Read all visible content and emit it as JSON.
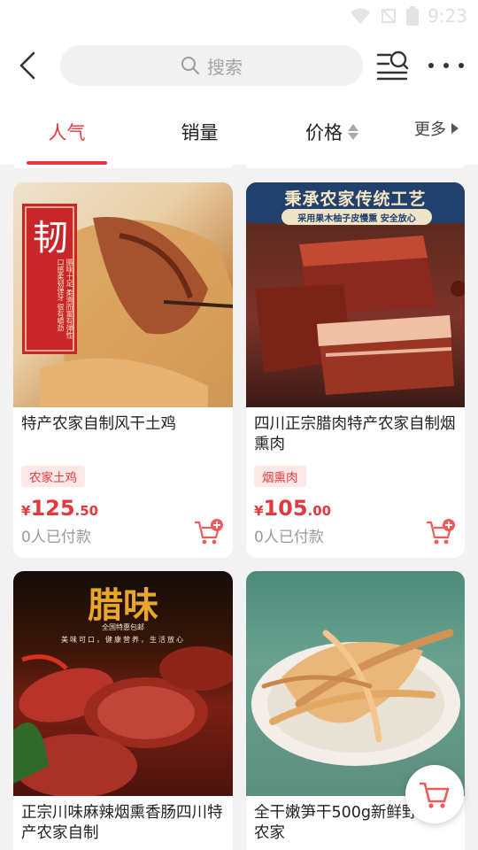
{
  "status": {
    "time": "9:23"
  },
  "header": {
    "search_placeholder": "搜索"
  },
  "tabs": [
    {
      "label": "人气",
      "active": true
    },
    {
      "label": "销量",
      "active": false
    },
    {
      "label": "价格",
      "active": false
    },
    {
      "label": "更多",
      "active": false
    }
  ],
  "products": [
    {
      "title": "特产农家自制风干土鸡",
      "tag": "农家土鸡",
      "price_symbol": "¥",
      "price_int": "125",
      "price_dec": ".50",
      "sold": "0人已付款",
      "image_text": {
        "big_char": "韧",
        "side_text": "腊味十足 柔滑而富有弹性 口感柔韧弹牙 很有嚼劲"
      }
    },
    {
      "title": "四川正宗腊肉特产农家自制烟熏肉",
      "tag": "烟熏肉",
      "price_symbol": "¥",
      "price_int": "105",
      "price_dec": ".00",
      "sold": "0人已付款",
      "image_text": {
        "banner": "秉承农家传统工艺",
        "sub": "采用果木柚子皮慢熏 安全放心"
      }
    },
    {
      "title": "正宗川味麻辣烟熏香肠四川特产农家自制",
      "image_text": {
        "big": "腊味",
        "sub": "全国特惠包邮",
        "line": "美味可口，健康营养，生活放心"
      }
    },
    {
      "title": "全干嫩笋干500g新鲜野生笋农家"
    }
  ],
  "colors": {
    "accent": "#e4393c",
    "tag_bg": "#fde8e8"
  }
}
